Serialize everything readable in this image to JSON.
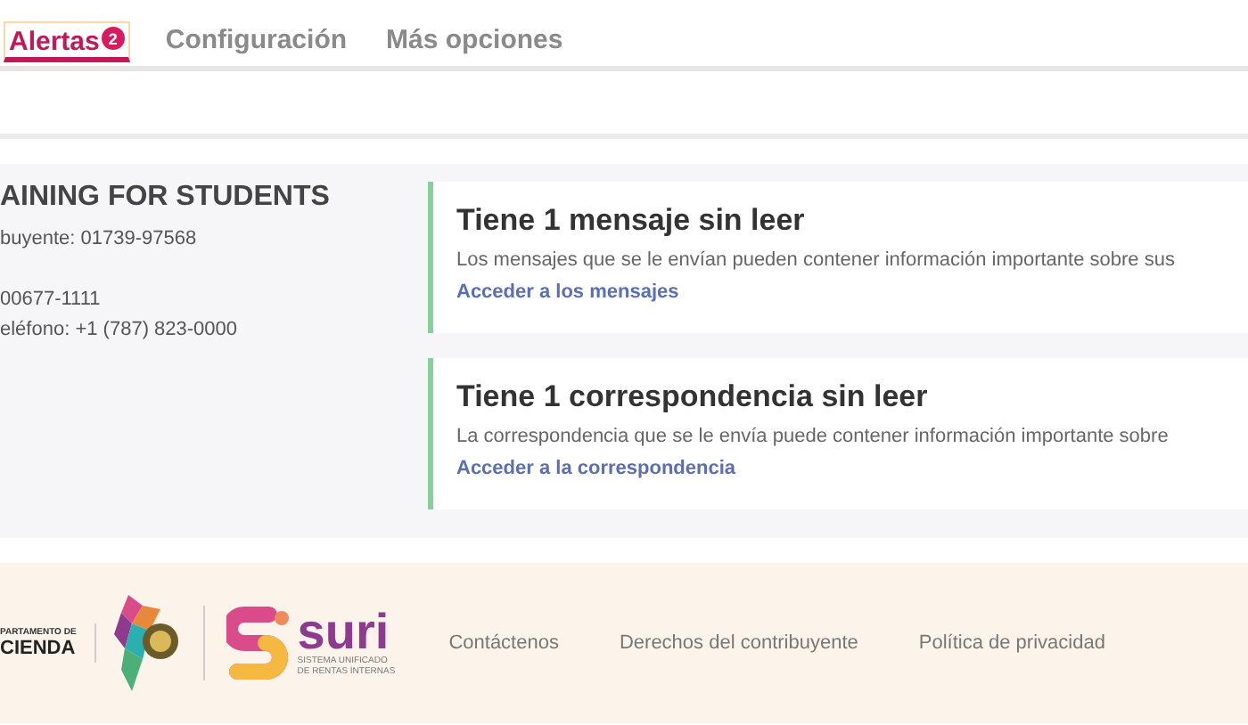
{
  "tabs": [
    {
      "label": "Alertas",
      "selected": true,
      "badge": "2"
    },
    {
      "label": "Configuración",
      "selected": false
    },
    {
      "label": "Más opciones",
      "selected": false
    }
  ],
  "profile": {
    "name": "AINING FOR STUDENTS",
    "line_groups": [
      [
        "buyente: 01739-97568"
      ],
      [
        "00677-1111",
        "eléfono: +1 (787) 823-0000"
      ]
    ]
  },
  "alerts": [
    {
      "title": "Tiene 1 mensaje sin leer",
      "text": "Los mensajes que se le envían pueden contener información importante sobre sus",
      "link": "Acceder a los mensajes"
    },
    {
      "title": "Tiene 1 correspondencia sin leer",
      "text": "La correspondencia que se le envía puede contener información importante sobre",
      "link": "Acceder a la correspondencia"
    }
  ],
  "footer": {
    "department": {
      "small": "PARTAMENTO DE",
      "big": "CIENDA"
    },
    "suri": {
      "name": "suri",
      "sub1": "SISTEMA UNIFICADO",
      "sub2": "DE RENTAS INTERNAS"
    },
    "links": [
      "Contáctenos",
      "Derechos del contribuyente",
      "Política de privacidad"
    ]
  }
}
